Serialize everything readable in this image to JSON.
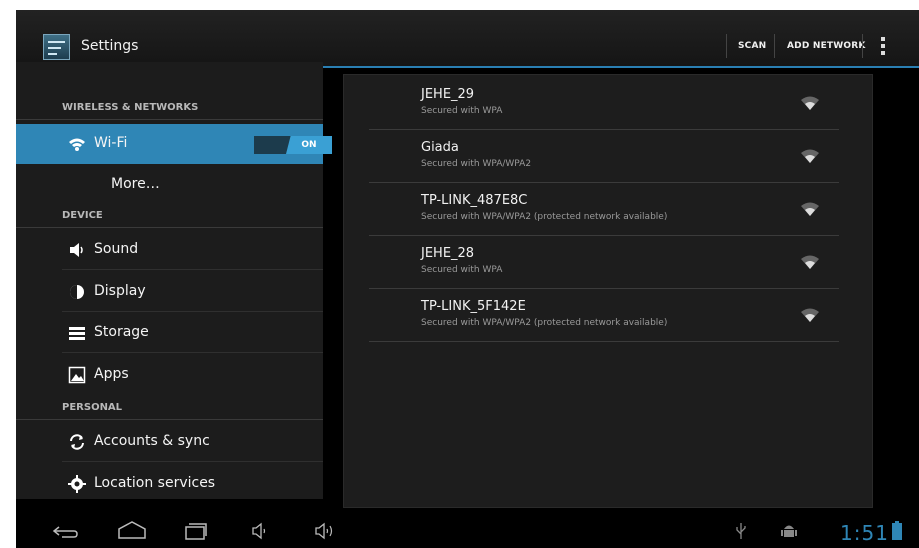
{
  "app": {
    "title": "Settings"
  },
  "actionbar": {
    "scan_label": "SCAN",
    "add_network_label": "ADD NETWORK"
  },
  "sidebar": {
    "categories": [
      "WIRELESS & NETWORKS",
      "DEVICE",
      "PERSONAL"
    ],
    "items": [
      {
        "label": "Wi-Fi",
        "icon": "wifi-icon",
        "selected": true,
        "toggle": "ON"
      },
      {
        "label": "More…",
        "icon": "",
        "selected": false
      },
      {
        "label": "Sound",
        "icon": "speaker-icon",
        "selected": false
      },
      {
        "label": "Display",
        "icon": "display-icon",
        "selected": false
      },
      {
        "label": "Storage",
        "icon": "storage-icon",
        "selected": false
      },
      {
        "label": "Apps",
        "icon": "apps-icon",
        "selected": false
      },
      {
        "label": "Accounts & sync",
        "icon": "sync-icon",
        "selected": false
      },
      {
        "label": "Location services",
        "icon": "location-icon",
        "selected": false
      }
    ]
  },
  "networks": [
    {
      "ssid": "JEHE_29",
      "security": "Secured with WPA",
      "icon": "wifi-signal-icon"
    },
    {
      "ssid": "Giada",
      "security": "Secured with WPA/WPA2",
      "icon": "wifi-signal-icon"
    },
    {
      "ssid": "TP-LINK_487E8C",
      "security": "Secured with WPA/WPA2 (protected network available)",
      "icon": "wifi-signal-icon"
    },
    {
      "ssid": "JEHE_28",
      "security": "Secured with WPA",
      "icon": "wifi-signal-icon"
    },
    {
      "ssid": "TP-LINK_5F142E",
      "security": "Secured with WPA/WPA2 (protected network available)",
      "icon": "wifi-signal-icon"
    }
  ],
  "statusbar": {
    "time": "1:51"
  },
  "colors": {
    "accent": "#2f86b6",
    "background": "#000000"
  }
}
